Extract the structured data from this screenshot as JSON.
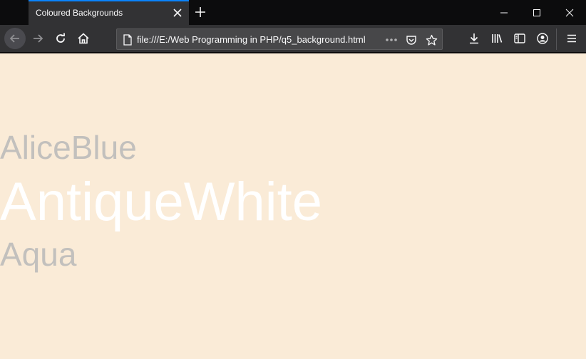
{
  "browser": {
    "tab": {
      "title": "Coloured Backgrounds"
    },
    "url": "file:///E:/Web Programming in PHP/q5_background.html"
  },
  "page": {
    "background_color": "#faebd7",
    "colour_names": [
      "AliceBlue",
      "AntiqueWhite",
      "Aqua"
    ]
  },
  "icons": {
    "tab_close": "close-icon",
    "new_tab": "plus-icon",
    "back": "arrow-left-icon",
    "forward": "arrow-right-icon",
    "reload": "reload-icon",
    "home": "home-icon",
    "page": "page-icon",
    "more": "ellipsis-icon",
    "pocket": "pocket-icon",
    "bookmark": "star-icon",
    "downloads": "download-icon",
    "library": "library-icon",
    "sidebar": "sidebar-icon",
    "account": "account-icon",
    "menu": "hamburger-icon"
  }
}
